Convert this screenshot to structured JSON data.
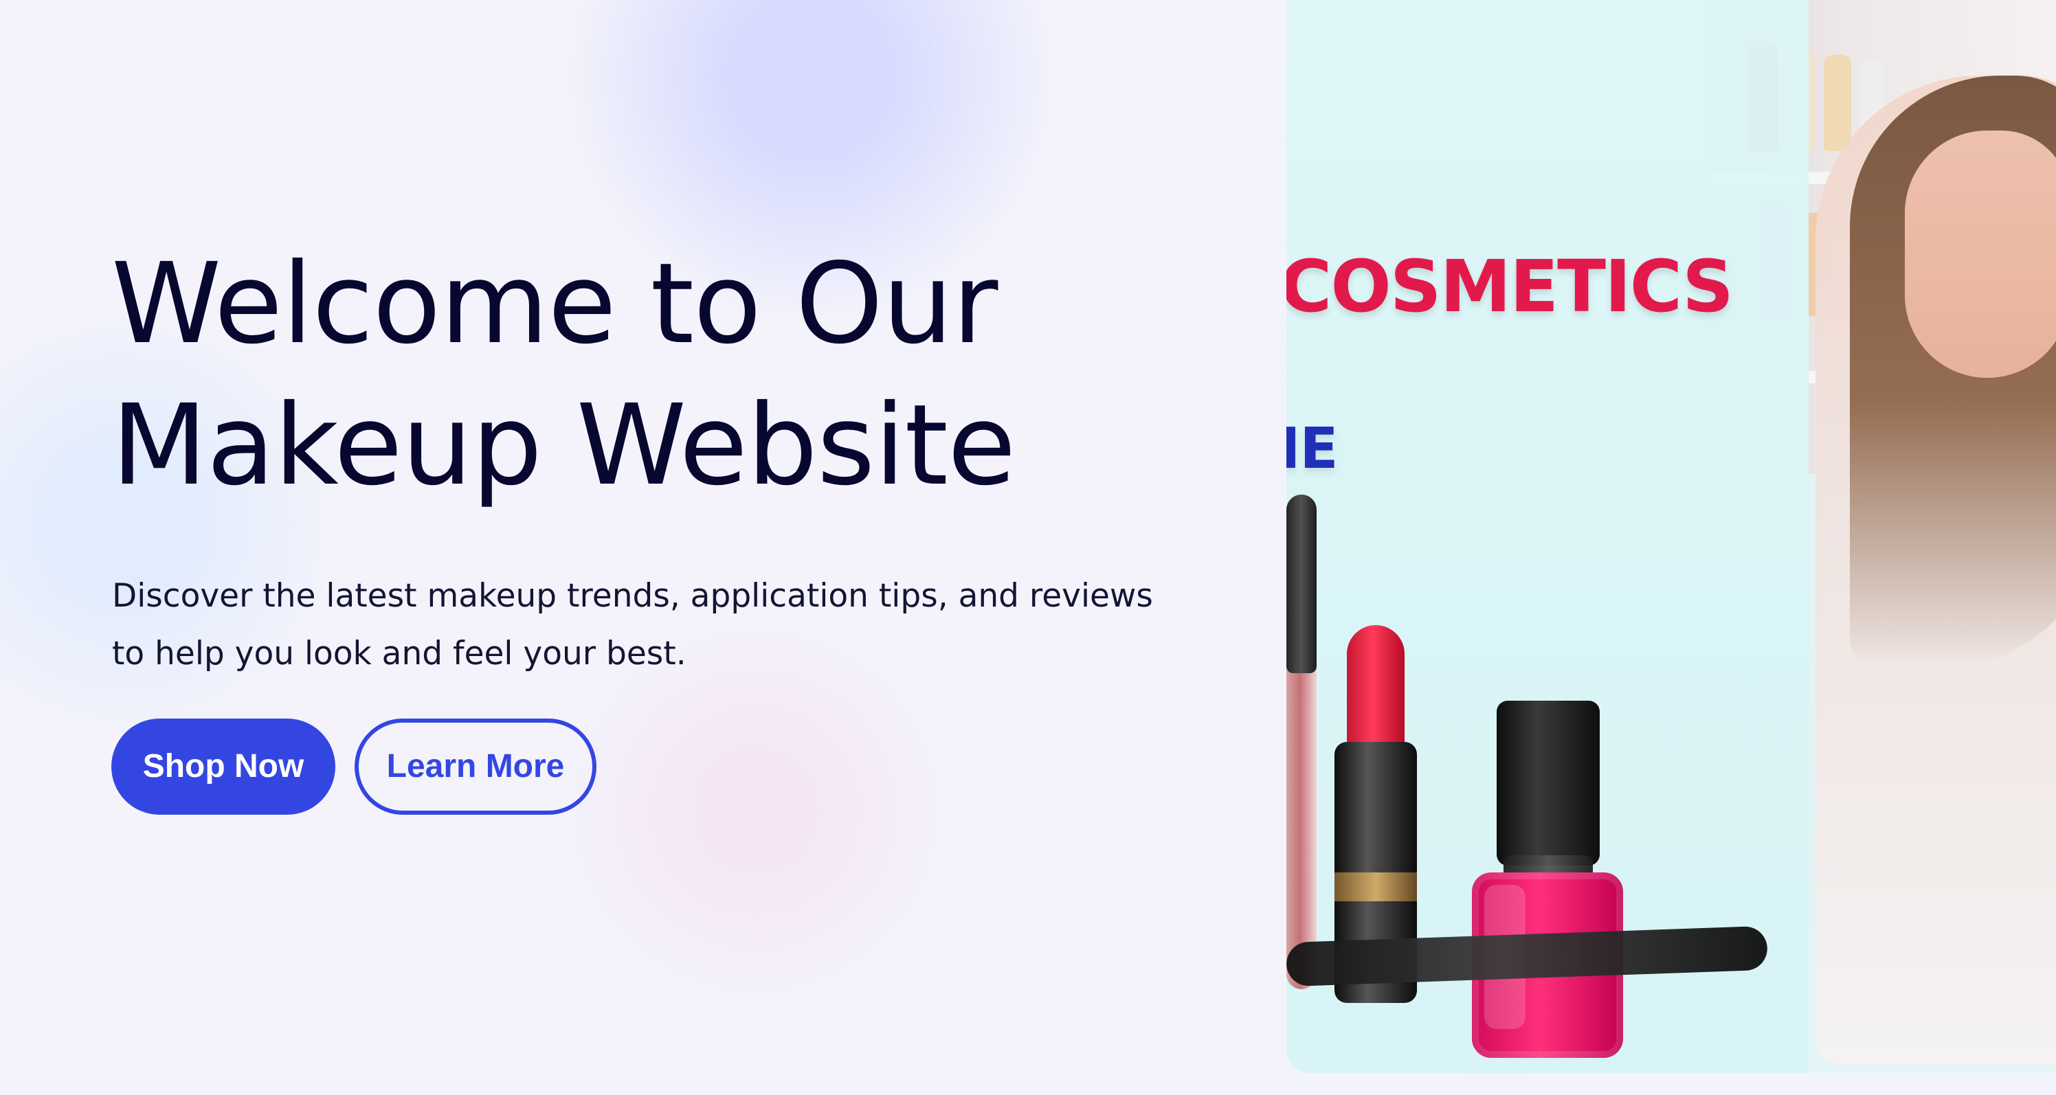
{
  "hero": {
    "title_line1": "Welcome to Our",
    "title_line2": "Makeup Website",
    "description": "Discover the latest makeup trends, application tips, and reviews to help you look and feel your best.",
    "buttons": {
      "primary": "Shop Now",
      "secondary": "Learn More"
    }
  },
  "media": {
    "overlay_text_brand": "COSMETICS",
    "overlay_text_sub": "IE"
  },
  "colors": {
    "accent": "#3446e2",
    "title": "#07072f",
    "brand_red": "#e21a4c",
    "brand_blue": "#1f2fb8",
    "bg": "#f2f2fb"
  }
}
